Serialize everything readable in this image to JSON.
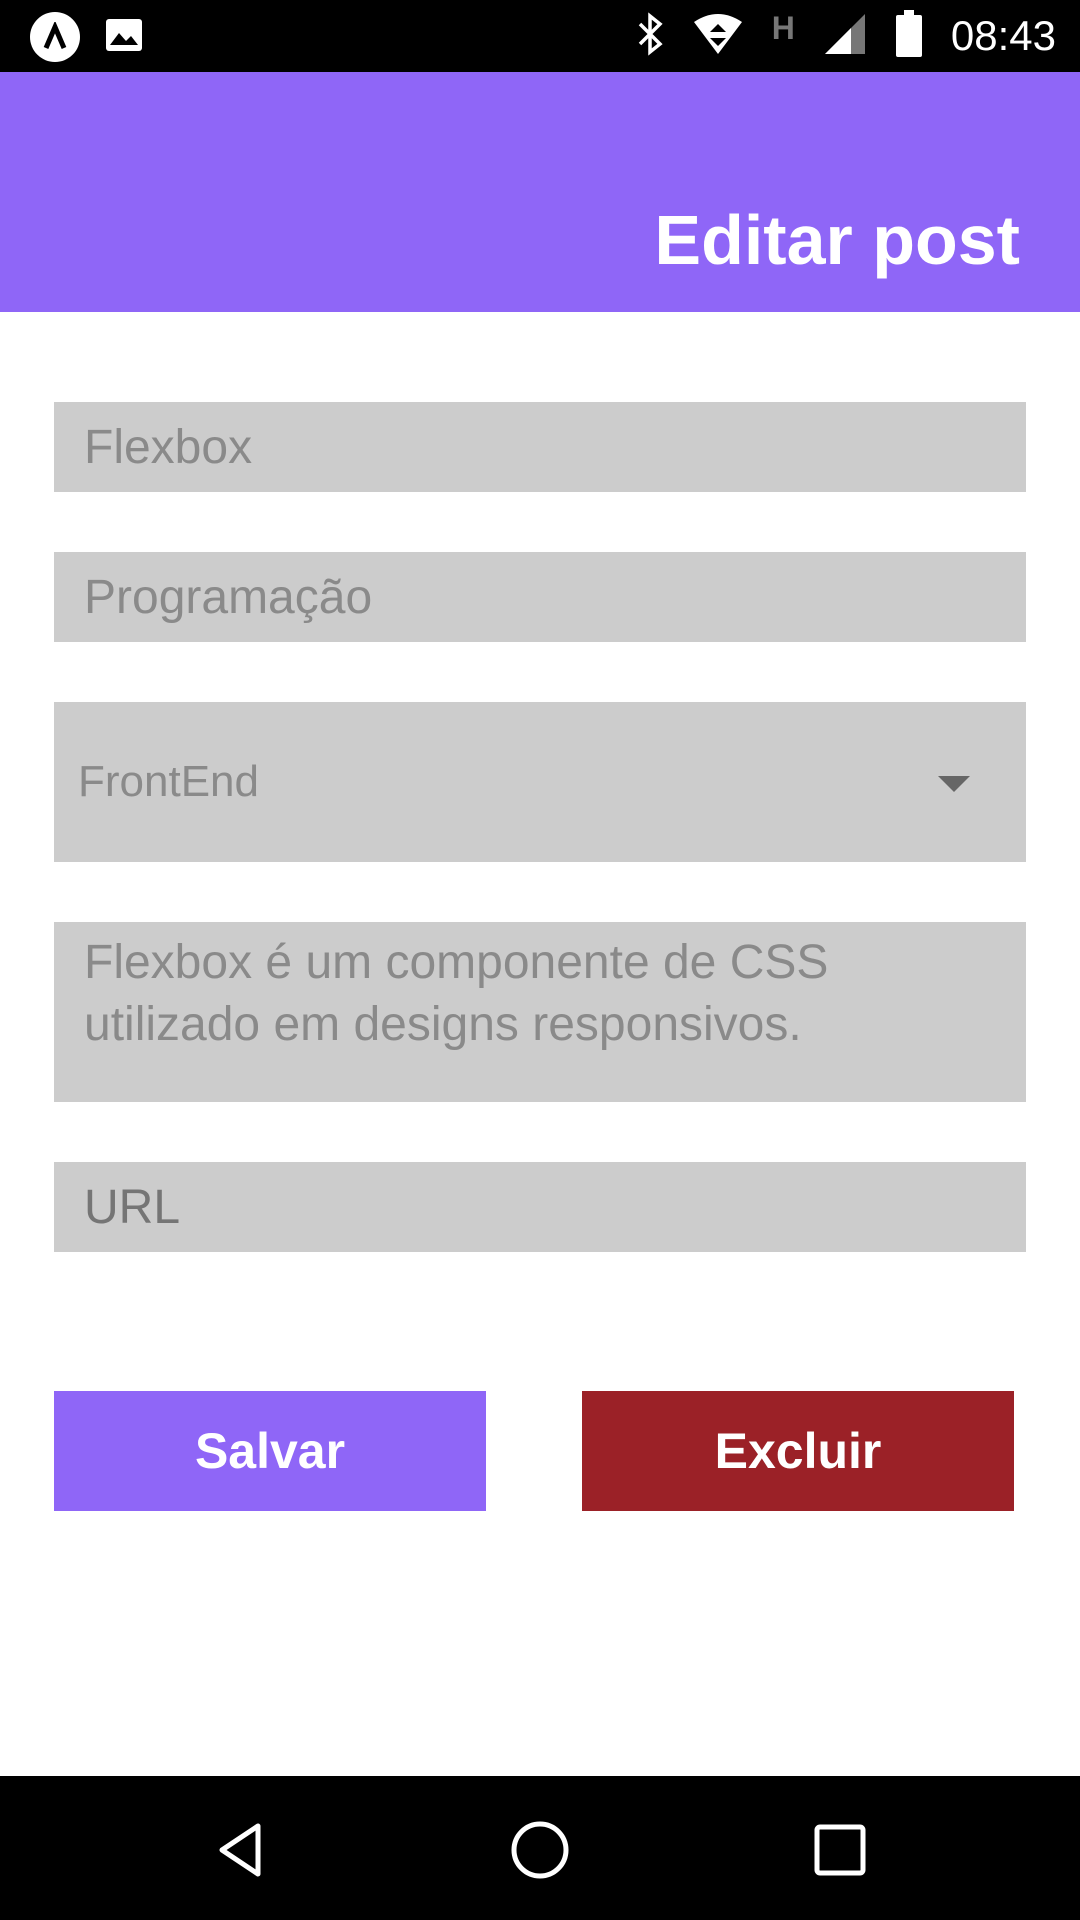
{
  "status_bar": {
    "time": "08:43",
    "icons": [
      "app-icon",
      "image-icon",
      "bluetooth-icon",
      "wifi-icon",
      "network-h-icon",
      "signal-icon",
      "battery-icon"
    ]
  },
  "header": {
    "title": "Editar post",
    "background": "#8f66f7"
  },
  "form": {
    "title_value": "Flexbox",
    "category_value": "Programação",
    "type_value": "FrontEnd",
    "description_value": "Flexbox é um componente de CSS\nutilizado em designs responsivos.",
    "url_placeholder": "URL"
  },
  "buttons": {
    "save_label": "Salvar",
    "delete_label": "Excluir",
    "save_color": "#8f66f7",
    "delete_color": "#9b2127"
  },
  "nav_bar": {
    "icons": [
      "back-icon",
      "home-icon",
      "recents-icon"
    ]
  }
}
